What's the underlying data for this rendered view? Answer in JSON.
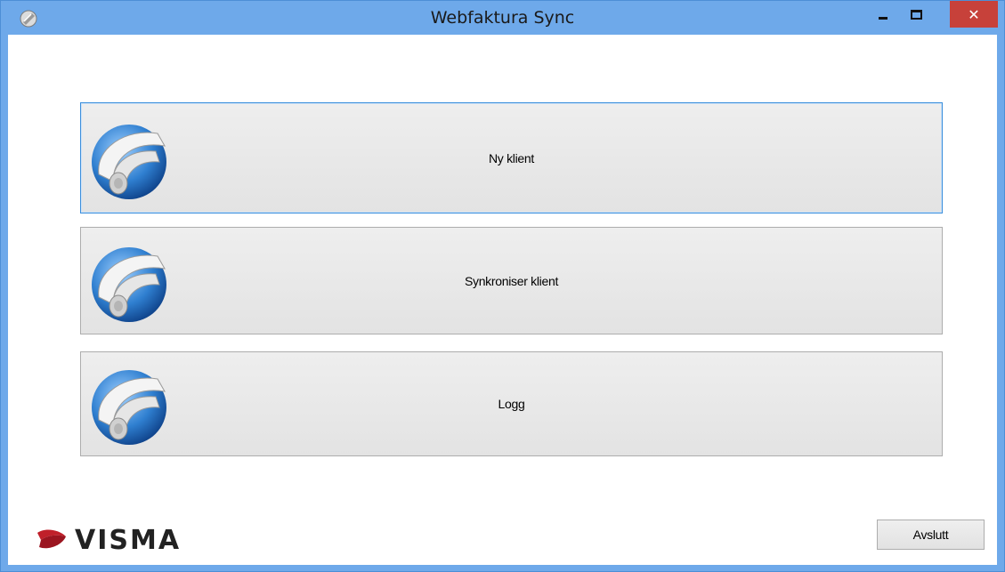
{
  "window": {
    "title": "Webfaktura Sync",
    "close_glyph": "✕"
  },
  "buttons": [
    {
      "label": "Ny klient",
      "icon": "scroll-sync-icon"
    },
    {
      "label": "Synkroniser klient",
      "icon": "scroll-sync-icon"
    },
    {
      "label": "Logg",
      "icon": "scroll-sync-icon"
    }
  ],
  "footer": {
    "logo_text": "VISMA",
    "exit_label": "Avslutt"
  },
  "colors": {
    "titlebar": "#6ea9ea",
    "close_button": "#c7413a",
    "focus_border": "#3c8fdc",
    "logo_red": "#c0202a",
    "icon_blue": "#2f7fd0"
  }
}
